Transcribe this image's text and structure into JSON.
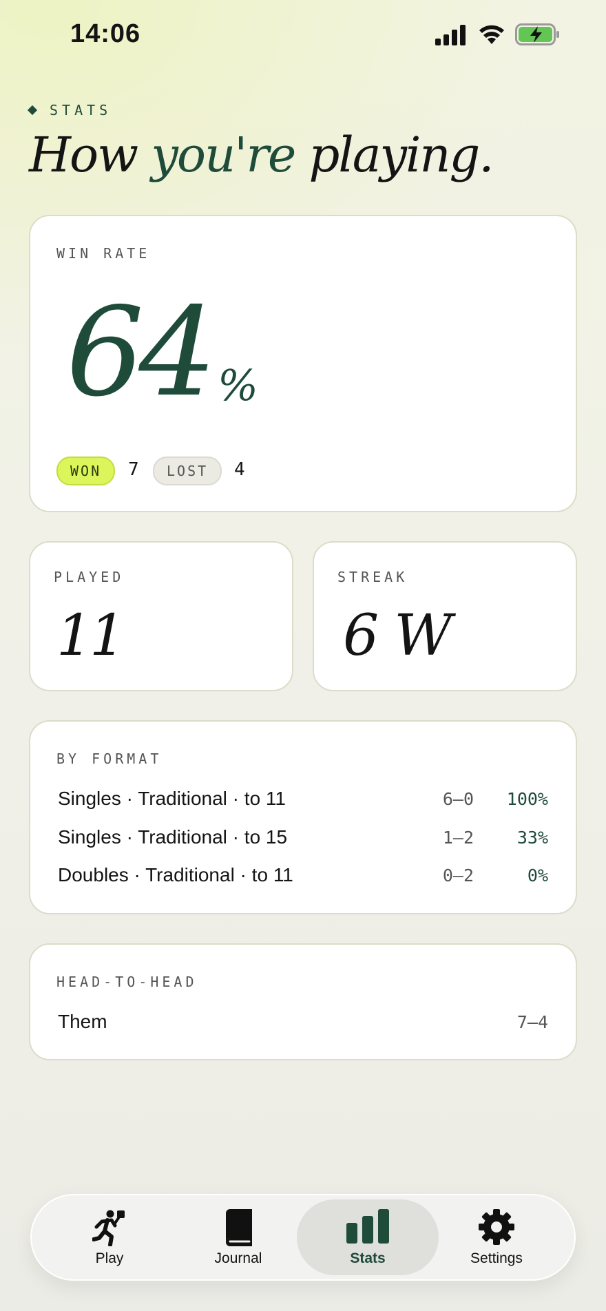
{
  "status_bar": {
    "time": "14:06"
  },
  "header": {
    "eyebrow": "STATS",
    "title_part1": "How",
    "title_part2": "you're",
    "title_part3": "playing."
  },
  "win_rate": {
    "label": "WIN RATE",
    "value": "64",
    "unit": "%",
    "won_label": "WON",
    "won_count": "7",
    "lost_label": "LOST",
    "lost_count": "4"
  },
  "played": {
    "label": "PLAYED",
    "value": "11"
  },
  "streak": {
    "label": "STREAK",
    "value": "6 W"
  },
  "by_format": {
    "label": "BY FORMAT",
    "rows": [
      {
        "name": "Singles · Traditional · to 11",
        "record": "6–0",
        "pct": "100%"
      },
      {
        "name": "Singles · Traditional · to 15",
        "record": "1–2",
        "pct": "33%"
      },
      {
        "name": "Doubles · Traditional · to 11",
        "record": "0–2",
        "pct": "0%"
      }
    ]
  },
  "head_to_head": {
    "label": "HEAD-TO-HEAD",
    "rows": [
      {
        "name": "Them",
        "record": "7–4"
      }
    ]
  },
  "tabs": [
    {
      "label": "Play",
      "icon": "running-figure-icon"
    },
    {
      "label": "Journal",
      "icon": "book-icon"
    },
    {
      "label": "Stats",
      "icon": "bar-chart-icon",
      "active": true
    },
    {
      "label": "Settings",
      "icon": "gear-icon"
    }
  ],
  "colors": {
    "accent": "#1f4b3b",
    "won_badge": "#dcf55a",
    "lost_badge": "#ebebe4"
  }
}
